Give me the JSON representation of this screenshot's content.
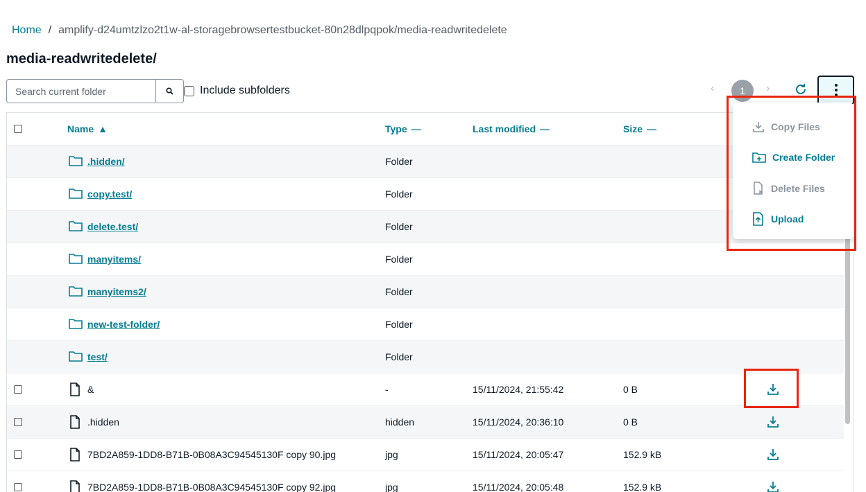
{
  "breadcrumb": {
    "home": "Home",
    "separator": "/",
    "path": "amplify-d24umtzlzo2t1w-al-storagebrowsertestbucket-80n28dlpqpok/media-readwritedelete"
  },
  "title": "media-readwritedelete/",
  "search": {
    "placeholder": "Search current folder",
    "value": ""
  },
  "include_subfolders_label": "Include subfolders",
  "pagination": {
    "prev": "‹",
    "current_page": "1",
    "next": "›"
  },
  "columns": {
    "name": "Name",
    "type": "Type",
    "last_modified": "Last modified",
    "size": "Size"
  },
  "folders": [
    {
      "name": ".hidden/",
      "type": "Folder"
    },
    {
      "name": "copy.test/",
      "type": "Folder"
    },
    {
      "name": "delete.test/",
      "type": "Folder"
    },
    {
      "name": "manyitems/",
      "type": "Folder"
    },
    {
      "name": "manyitems2/",
      "type": "Folder"
    },
    {
      "name": "new-test-folder/",
      "type": "Folder"
    },
    {
      "name": "test/",
      "type": "Folder"
    }
  ],
  "files": [
    {
      "name": "&",
      "type": "-",
      "last_modified": "15/11/2024, 21:55:42",
      "size": "0 B"
    },
    {
      "name": ".hidden",
      "type": "hidden",
      "last_modified": "15/11/2024, 20:36:10",
      "size": "0 B"
    },
    {
      "name": "7BD2A859-1DD8-B71B-0B08A3C94545130F copy 90.jpg",
      "type": "jpg",
      "last_modified": "15/11/2024, 20:05:47",
      "size": "152.9 kB"
    },
    {
      "name": "7BD2A859-1DD8-B71B-0B08A3C94545130F copy 92.jpg",
      "type": "jpg",
      "last_modified": "15/11/2024, 20:05:48",
      "size": "152.9 kB"
    }
  ],
  "actions_menu": {
    "copy_files": "Copy Files",
    "create_folder": "Create Folder",
    "delete_files": "Delete Files",
    "upload": "Upload"
  },
  "colors": {
    "accent": "#047d95",
    "highlight": "#e8250c",
    "disabled": "#8b949e"
  }
}
